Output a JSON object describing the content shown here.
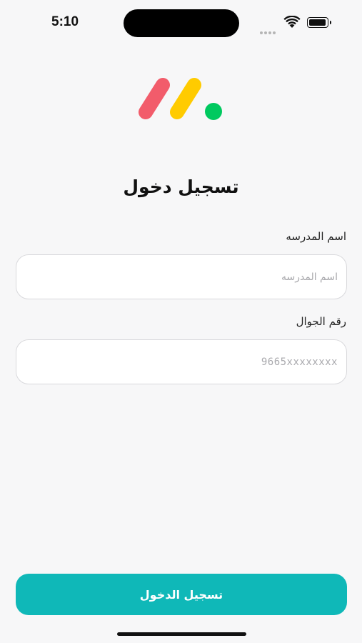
{
  "status_bar": {
    "time": "5:10"
  },
  "logo": {
    "icon": "monday-logo-icon",
    "colors": [
      "#f25c6b",
      "#ffcb00",
      "#00c95f"
    ]
  },
  "login": {
    "title": "تسجيل دخول",
    "school_name_label": "اسم المدرسه",
    "school_name_placeholder": "اسم المدرسه",
    "school_name_value": "",
    "phone_label": "رقم الجوال",
    "phone_placeholder": "9665xxxxxxxx",
    "phone_value": "",
    "submit_label": "تسجيل الدخول"
  },
  "colors": {
    "accent": "#0fb8b8",
    "background": "#f7f7f8"
  }
}
